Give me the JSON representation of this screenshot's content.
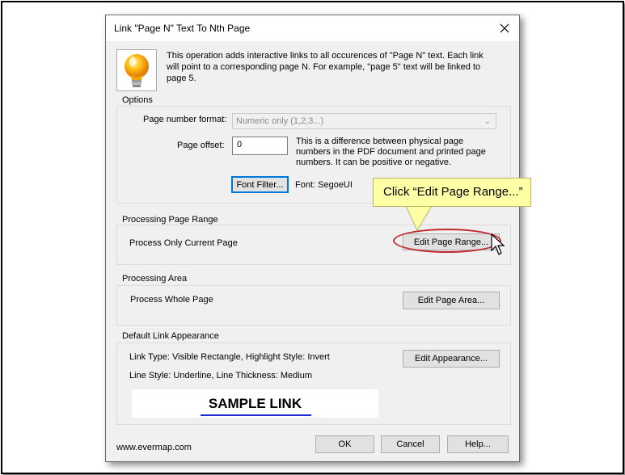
{
  "dialog": {
    "title": "Link \"Page N\" Text To Nth Page",
    "info_text": "This operation adds interactive links to all occurences of \"Page N\" text. Each link will point to a corresponding page N. For example, \"page 5\" text will be linked to page 5."
  },
  "options": {
    "group_title": "Options",
    "page_number_format_label": "Page number format:",
    "page_number_format_value": "Numeric only (1,2,3...)",
    "page_offset_label": "Page offset:",
    "page_offset_value": "0",
    "page_offset_hint": "This is a difference between physical page numbers in the PDF document and printed page numbers. It can be positive or negative.",
    "font_filter_button": "Font Filter...",
    "font_label": "Font: SegoeUI"
  },
  "page_range": {
    "group_title": "Processing Page Range",
    "status": "Process Only Current Page",
    "edit_button": "Edit Page Range..."
  },
  "area": {
    "group_title": "Processing Area",
    "status": "Process Whole Page",
    "edit_button": "Edit Page Area..."
  },
  "appearance": {
    "group_title": "Default Link Appearance",
    "line1": "Link Type: Visible Rectangle, Highlight Style: Invert",
    "line2": "Line Style: Underline, Line Thickness: Medium",
    "edit_button": "Edit Appearance...",
    "sample_text": "SAMPLE LINK",
    "sample_underline_color": "#1a2bd6"
  },
  "footer": {
    "website": "www.evermap.com",
    "ok_button": "OK",
    "cancel_button": "Cancel",
    "help_button": "Help..."
  },
  "callout": {
    "text": "Click “Edit Page Range...”",
    "background": "#ffffa6"
  },
  "colors": {
    "dialog_bg": "#f0f0f0",
    "highlight_ellipse": "#c0282e",
    "focus_border": "#0078d7"
  }
}
